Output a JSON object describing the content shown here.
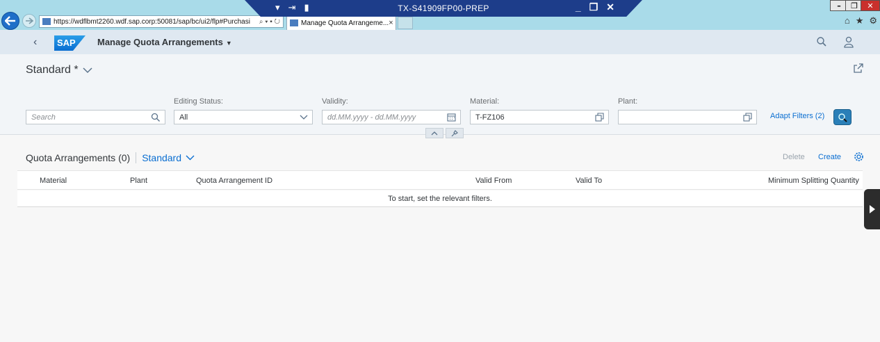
{
  "browser": {
    "url": "https://wdflbmt2260.wdf.sap.corp:50081/sap/bc/ui2/flp#Purchasi",
    "tab_title": "Manage Quota Arrangeme...",
    "tab_close": "×",
    "remote_title": "TX-S41909FP00-PREP"
  },
  "shell": {
    "logo": "SAP",
    "app_title": "Manage Quota Arrangements",
    "icons": [
      "back-chevron-icon",
      "search-icon",
      "user-icon"
    ]
  },
  "header": {
    "variant_name": "Standard *"
  },
  "filters": {
    "search_placeholder": "Search",
    "editing_status_label": "Editing Status:",
    "editing_status_value": "All",
    "validity_label": "Validity:",
    "validity_placeholder": "dd.MM.yyyy - dd.MM.yyyy",
    "material_label": "Material:",
    "material_value": "T-FZ106",
    "plant_label": "Plant:",
    "plant_value": "",
    "adapt_filters": "Adapt Filters (2)"
  },
  "table": {
    "title": "Quota Arrangements (0)",
    "variant": "Standard",
    "delete_label": "Delete",
    "create_label": "Create",
    "columns": [
      "Material",
      "Plant",
      "Quota Arrangement ID",
      "Valid From",
      "Valid To",
      "Minimum Splitting Quantity"
    ],
    "empty_text": "To start, set the relevant filters."
  }
}
